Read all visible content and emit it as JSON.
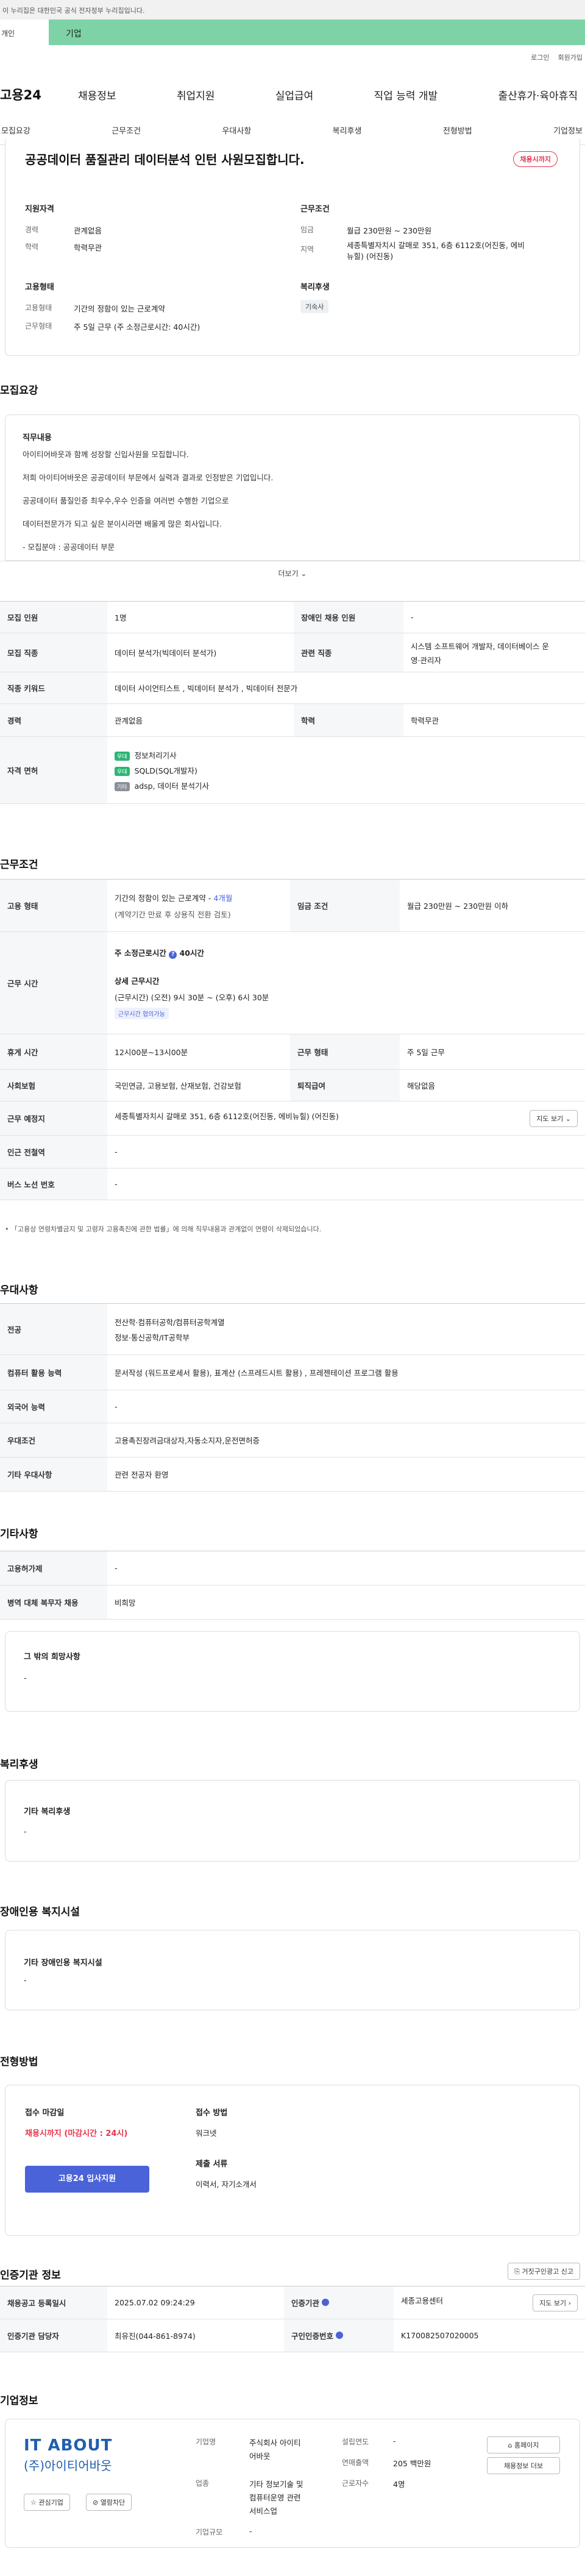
{
  "gov": {
    "notice": "이 누리집은 대한민국 공식 전자정부 누리집입니다."
  },
  "tabs": {
    "personal": "개인",
    "corporate": "기업"
  },
  "utils": {
    "login": "로그인",
    "join": "회원가입"
  },
  "brand": "고용24",
  "gnb": [
    "채용정보",
    "취업지원",
    "실업급여",
    "직업 능력 개발",
    "출산휴가·육아휴직"
  ],
  "subnav": [
    "모집요강",
    "근무조건",
    "우대사항",
    "복리후생",
    "전형방법",
    "기업정보"
  ],
  "job": {
    "title": "공공데이터 품질관리 데이터분석 인턴 사원모집합니다.",
    "badge": "채용시까지",
    "qual_h": "지원자격",
    "career_l": "경력",
    "career_v": "관계없음",
    "edu_l": "학력",
    "edu_v": "학력무관",
    "cond_h": "근무조건",
    "wage_l": "임금",
    "wage_v": "월급 230만원 ~ 230만원",
    "loc_l": "지역",
    "loc_v1": "세종특별자치시 갈매로 351, 6층 6112호(어진동, 에비",
    "loc_v2": "뉴힐) (어진동)",
    "emp_h": "고용형태",
    "emp_l": "고용형태",
    "emp_v": "기간의 정함이 있는 근로계약",
    "work_l": "근무형태",
    "work_v": "주 5일 근무 (주 소정근로시간: 40시간)",
    "wel_h": "복리후생",
    "wel_chip": "기숙사"
  },
  "recruit": {
    "h": "모집요강",
    "duty_h": "직무내용",
    "lines": [
      "아이티어바웃과 함께 성장할 신입사원을 모집합니다.",
      "저희 아이티어바웃은 공공데이터 부문에서 실력과 결과로 인정받은 기업입니다.",
      "공공데이터 품질인증 최우수,우수 인증을 여러번 수행한 기업으로",
      "데이터전문가가 되고 싶은 분이시라면 배울게 많은 회사입니다.",
      "- 모집분야 : 공공데이터 부문"
    ],
    "more": "더보기 ⌄"
  },
  "rt": {
    "cnt_l": "모집 인원",
    "cnt_v": "1명",
    "dis_l": "장애인 채용 인원",
    "dis_v": "-",
    "job_l": "모집 직종",
    "job_v": "데이터 분석가(빅데이터 분석가)",
    "rel_l": "관련 직종",
    "rel_v1": "시스템 소프트웨어 개발자, 데이터베이스 운",
    "rel_v2": "영·관리자",
    "kw_l": "직종 키워드",
    "kw_v": "데이터 사이언티스트 , 빅데이터 분석가 , 빅데이터 전문가",
    "car_l": "경력",
    "car_v": "관계없음",
    "edu_l": "학력",
    "edu_v": "학력무관",
    "lic_l": "자격 면허",
    "lic": [
      {
        "tag": "우대",
        "name": "정보처리기사"
      },
      {
        "tag": "우대",
        "name": "SQLD(SQL개발자)"
      },
      {
        "tag": "기타",
        "name": "adsp, 데이터 분석기사"
      }
    ],
    "tag_green": "#2bb673",
    "tag_gray": "#8a9099"
  },
  "cond": {
    "h": "근무조건",
    "emp_l": "고용 형태",
    "emp_v1": "기간의 정함이 있는 근로계약 - ",
    "emp_month": "4개월",
    "emp_v2": "(계약기간 만료 후 상용직 전환 검토)",
    "wage_l": "임금 조건",
    "wage_v": "월급 230만원 ~ 230만원 이하",
    "time_l": "근무 시간",
    "week": "주 소정근로시간",
    "week_v": "40시간",
    "detail_h": "상세 근무시간",
    "detail_v": "(근무시간) (오전) 9시 30분 ~ (오후) 6시 30분",
    "flex": "근무시간 협의가능",
    "rest_l": "휴게 시간",
    "rest_v": "12시00분~13시00분",
    "form_l": "근무 형태",
    "form_v": "주 5일 근무",
    "ins_l": "사회보험",
    "ins_v": "국민연금, 고용보험, 산재보험, 건강보험",
    "ret_l": "퇴직급여",
    "ret_v": "해당없음",
    "place_l": "근무 예정지",
    "place_v": "세종특별자치시 갈매로 351, 6층 6112호(어진동, 에비뉴힐) (어진동)",
    "map": "지도 보기 ⌄",
    "sub_l": "인근 전철역",
    "sub_v": "-",
    "bus_l": "버스 노선 번호",
    "bus_v": "-",
    "note": "• 「고용상 연령차별금지 및 고령자 고용촉진에 관한 법률」에 의해 직무내용과 관계없이 연령이 삭제되었습니다."
  },
  "pref": {
    "h": "우대사항",
    "major_l": "전공",
    "major_v1": "전산학·컴퓨터공학/컴퓨터공학계열",
    "major_v2": "정보·통신공학/IT공학부",
    "pc_l": "컴퓨터 활용 능력",
    "pc_v": "문서작성 (워드프로세서 활용), 표계산 (스프레드시트 활용) , 프레젠테이션 프로그램 활용",
    "lang_l": "외국어 능력",
    "lang_v": "-",
    "cond_l": "우대조건",
    "cond_v": "고용촉진장려금대상자,자동소지자,운전면허증",
    "etc_l": "기타 우대사항",
    "etc_v": "관련 전공자 환영"
  },
  "other": {
    "h": "기타사항",
    "emp_l": "고용허가제",
    "emp_v": "-",
    "mil_l": "병역 대체 복무자 채용",
    "mil_v": "비희망",
    "hope_h": "그 밖의 희망사항",
    "hope_v": "-"
  },
  "welfare": {
    "h": "복리후생",
    "sub": "기타 복리후생",
    "v": "-"
  },
  "disab": {
    "h": "장애인용 복지시설",
    "sub": "기타 장애인용 복지시설",
    "v": "-"
  },
  "sel": {
    "h": "전형방법",
    "deadline_h": "접수 마감일",
    "deadline_v": "채용시까지 (마감시간 : 24시)",
    "apply_btn": "고용24 입사지원",
    "method_h": "접수 방법",
    "method_v": "워크넷",
    "doc_h": "제출 서류",
    "doc_v": "이력서, 자기소개서"
  },
  "agency": {
    "h": "인증기관 정보",
    "report": "거짓구인광고 신고",
    "date_l": "채용공고 등록일시",
    "date_v": "2025.07.02 09:24:29",
    "org_l": "인증기관",
    "org_v": "세종고용센터",
    "map": "지도 보기 ›",
    "mgr_l": "인증기관 담당자",
    "mgr_v": "최유진(044-861-8974)",
    "num_l": "구인인증번호",
    "num_v": "K170082507020005"
  },
  "company": {
    "h": "기업정보",
    "logo_top": "IT ABOUT",
    "logo_ko": "(주)아이티어바웃",
    "fav": "관심기업",
    "block": "열람차단",
    "ceo_l": "기업명",
    "ceo_v1": "주식회사 아이티",
    "ceo_v2": "어바웃",
    "ind_l": "업종",
    "ind_v1": "기타 정보기술 및",
    "ind_v2": "컴퓨터운영 관련",
    "ind_v3": "서비스업",
    "size_l": "기업규모",
    "size_v": "-",
    "est_l": "설립연도",
    "est_v": "-",
    "rev_l": "연매출액",
    "rev_v": "205 백만원",
    "emp_l": "근로자수",
    "emp_v": "4명",
    "home": "홈페이지",
    "list": "채용정보 더보",
    "logo_blue": "#1f5fae"
  },
  "colors": {
    "accent": "#4a63d9",
    "red": "#e8344e",
    "green": "#7dd3a6"
  }
}
